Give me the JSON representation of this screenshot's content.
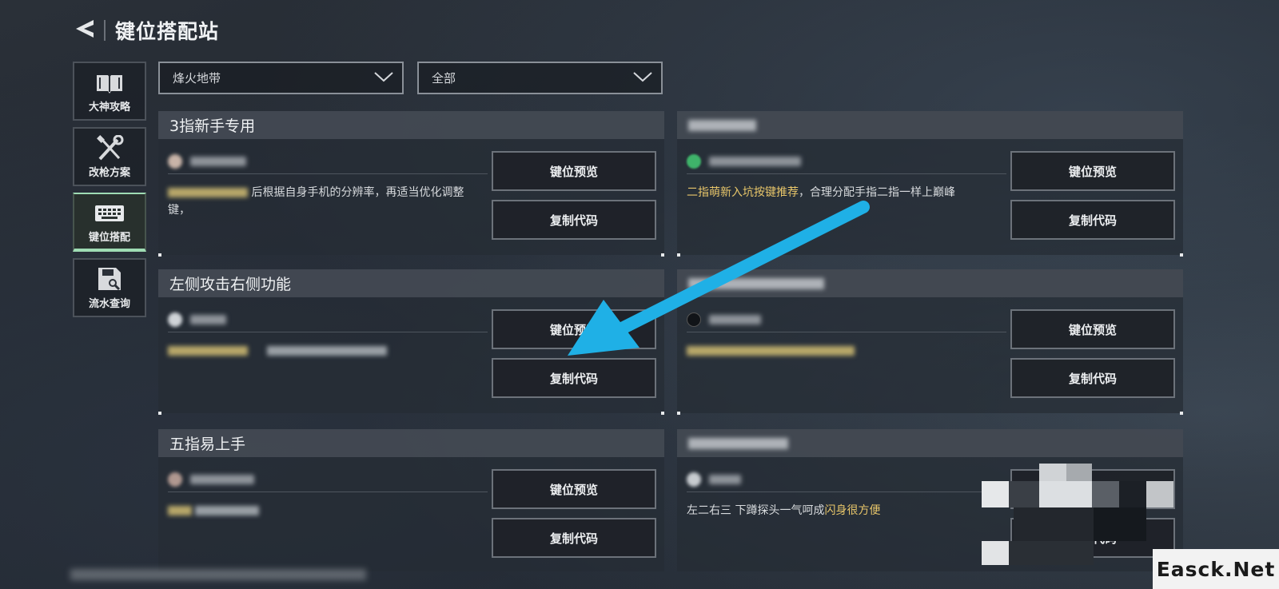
{
  "header": {
    "title": "键位搭配站"
  },
  "sidebar": {
    "items": [
      {
        "label": "大神攻略",
        "icon": "book-icon",
        "active": false
      },
      {
        "label": "改枪方案",
        "icon": "wrench-screwdriver-icon",
        "active": false
      },
      {
        "label": "键位搭配",
        "icon": "keyboard-icon",
        "active": true
      },
      {
        "label": "流水查询",
        "icon": "floppy-search-icon",
        "active": false
      }
    ]
  },
  "filters": {
    "mode": {
      "value": "烽火地带"
    },
    "category": {
      "value": "全部"
    }
  },
  "cards": [
    {
      "title": "3指新手专用",
      "desc_highlight": "",
      "desc": "后根据自身手机的分辨率，再适当优化调整键，",
      "btn_preview": "键位预览",
      "btn_copy": "复制代码"
    },
    {
      "title": "",
      "desc_highlight": "二指萌新入坑按键推荐",
      "desc": "，合理分配手指二指一样上巅峰",
      "btn_preview": "键位预览",
      "btn_copy": "复制代码"
    },
    {
      "title": "左侧攻击右侧功能",
      "desc_highlight": "",
      "desc": "",
      "btn_preview": "键位预览",
      "btn_copy": "复制代码"
    },
    {
      "title": "",
      "desc_highlight": "",
      "desc": "",
      "btn_preview": "键位预览",
      "btn_copy": "复制代码"
    },
    {
      "title": "五指易上手",
      "desc_highlight": "",
      "desc": "",
      "btn_preview": "键位预览",
      "btn_copy": "复制代码"
    },
    {
      "title": "",
      "desc_highlight": "闪身很方便",
      "desc": "左二右三 下蹲探头一气呵成",
      "btn_preview": "键位预览",
      "btn_copy": "复制代码"
    }
  ],
  "watermark": "Easck.Net",
  "colors": {
    "accent_active": "#9fdcb4",
    "highlight_text": "#e8c66a",
    "arrow": "#1fb0e6"
  }
}
